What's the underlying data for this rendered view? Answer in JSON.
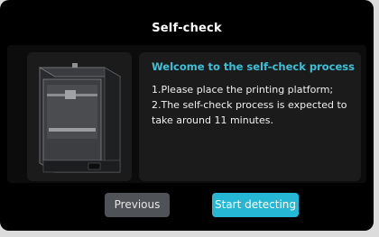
{
  "dialog": {
    "title": "Self-check"
  },
  "info": {
    "heading": "Welcome to the self-check process",
    "lines": [
      "1.Please place the printing platform;",
      "2.The self-check process is expected to take around 11 minutes."
    ]
  },
  "buttons": {
    "previous_label": "Previous",
    "start_label": "Start detecting"
  },
  "colors": {
    "accent": "#25b7d3",
    "heading": "#3cc1d8",
    "background": "#000000",
    "card": "#1b1b1b",
    "secondary_button": "#4f5256"
  },
  "icons": {
    "printer": "3d-printer-image"
  }
}
